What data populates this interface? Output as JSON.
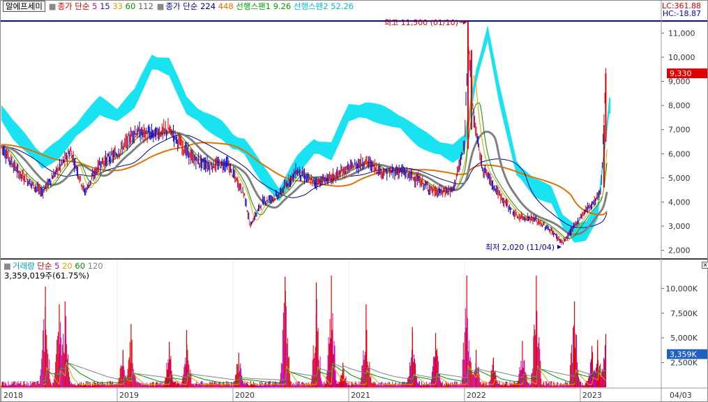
{
  "app": {
    "stock_name": "알에프세미",
    "lc_label": "LC:361.88",
    "hc_label": "HC:-18.87",
    "last_date_label": "04/03"
  },
  "price_legend": {
    "ma_label": "종가 단순",
    "ma_periods": [
      {
        "value": "5",
        "color": "#c000c0"
      },
      {
        "value": "15",
        "color": "#202090"
      },
      {
        "value": "33",
        "color": "#e0a000"
      },
      {
        "value": "60",
        "color": "#009000"
      },
      {
        "value": "112",
        "color": "#606060"
      }
    ],
    "ma2_label": "종가 단순",
    "ma2_periods": [
      {
        "value": "224",
        "color": "#000080"
      },
      {
        "value": "448",
        "color": "#e07000"
      }
    ],
    "span1": "선행스팬1 9.26",
    "span2": "선행스팬2 52.26"
  },
  "volume_legend": {
    "title": "거래량",
    "ma_label": "단순",
    "periods": [
      {
        "value": "5",
        "color": "#c000c0"
      },
      {
        "value": "20",
        "color": "#e0a000"
      },
      {
        "value": "60",
        "color": "#009000"
      },
      {
        "value": "120",
        "color": "#808080"
      }
    ],
    "current": "3,359,019주(61.75%)"
  },
  "annotations": {
    "high": "최고 11,500 (01/10)",
    "low": "최저 2,020 (11/04)"
  },
  "colors": {
    "up": "#e00000",
    "down": "#0000cc",
    "cloud": "#00e0f0",
    "hc_line": "#00009a",
    "badge_price": "#e00000",
    "badge_volume": "#2060c0"
  },
  "chart_data": [
    {
      "type": "candlestick",
      "title": "알에프세미",
      "ylim": [
        2000,
        11500
      ],
      "y_ticks": [
        "2,000",
        "3,000",
        "4,000",
        "5,000",
        "6,000",
        "7,000",
        "8,000",
        "9,000",
        "10,000",
        "11,000"
      ],
      "x_ticks": [
        "2018",
        "2019",
        "2020",
        "2021",
        "2022",
        "2023",
        "04/03"
      ],
      "current_price": "9,330",
      "high": {
        "value": 11500,
        "date": "01/10"
      },
      "low": {
        "value": 2020,
        "date": "11/04"
      },
      "price_path": [
        [
          2018.0,
          6300
        ],
        [
          2018.15,
          5200
        ],
        [
          2018.35,
          4400
        ],
        [
          2018.48,
          5300
        ],
        [
          2018.6,
          6100
        ],
        [
          2018.72,
          4400
        ],
        [
          2018.85,
          5600
        ],
        [
          2019.0,
          6000
        ],
        [
          2019.15,
          6900
        ],
        [
          2019.3,
          6800
        ],
        [
          2019.45,
          7000
        ],
        [
          2019.55,
          6400
        ],
        [
          2019.65,
          5800
        ],
        [
          2019.8,
          5500
        ],
        [
          2019.95,
          5600
        ],
        [
          2020.1,
          4300
        ],
        [
          2020.15,
          3000
        ],
        [
          2020.25,
          4000
        ],
        [
          2020.4,
          4300
        ],
        [
          2020.55,
          5300
        ],
        [
          2020.7,
          4800
        ],
        [
          2020.85,
          5000
        ],
        [
          2021.0,
          5400
        ],
        [
          2021.15,
          5700
        ],
        [
          2021.3,
          5200
        ],
        [
          2021.45,
          5300
        ],
        [
          2021.6,
          4900
        ],
        [
          2021.75,
          4400
        ],
        [
          2021.9,
          4500
        ],
        [
          2022.0,
          6300
        ],
        [
          2022.03,
          10800
        ],
        [
          2022.08,
          7500
        ],
        [
          2022.15,
          5500
        ],
        [
          2022.3,
          4300
        ],
        [
          2022.45,
          3400
        ],
        [
          2022.6,
          3300
        ],
        [
          2022.75,
          2800
        ],
        [
          2022.85,
          2300
        ],
        [
          2022.95,
          3000
        ],
        [
          2023.05,
          3700
        ],
        [
          2023.12,
          4000
        ],
        [
          2023.18,
          4500
        ],
        [
          2023.22,
          9300
        ]
      ],
      "cloud_path": [
        [
          2018.0,
          7700
        ],
        [
          2018.1,
          7000
        ],
        [
          2018.2,
          6500
        ],
        [
          2018.35,
          5700
        ],
        [
          2018.5,
          6200
        ],
        [
          2018.65,
          7000
        ],
        [
          2018.85,
          8000
        ],
        [
          2019.0,
          7600
        ],
        [
          2019.15,
          8300
        ],
        [
          2019.3,
          9800
        ],
        [
          2019.45,
          9600
        ],
        [
          2019.6,
          8000
        ],
        [
          2019.75,
          7400
        ],
        [
          2019.9,
          7000
        ],
        [
          2020.0,
          6500
        ],
        [
          2020.1,
          6300
        ],
        [
          2020.25,
          5200
        ],
        [
          2020.4,
          4300
        ],
        [
          2020.55,
          5500
        ],
        [
          2020.7,
          6300
        ],
        [
          2020.85,
          6100
        ],
        [
          2021.0,
          7700
        ],
        [
          2021.15,
          7800
        ],
        [
          2021.3,
          7600
        ],
        [
          2021.45,
          7300
        ],
        [
          2021.6,
          6700
        ],
        [
          2021.75,
          6300
        ],
        [
          2021.9,
          6000
        ],
        [
          2022.0,
          6400
        ],
        [
          2022.1,
          9200
        ],
        [
          2022.2,
          11000
        ],
        [
          2022.3,
          8500
        ],
        [
          2022.45,
          5400
        ],
        [
          2022.6,
          4600
        ],
        [
          2022.75,
          4300
        ],
        [
          2022.85,
          3200
        ],
        [
          2022.95,
          2700
        ],
        [
          2023.05,
          2800
        ],
        [
          2023.15,
          3600
        ],
        [
          2023.25,
          8000
        ]
      ]
    },
    {
      "type": "bar",
      "title": "거래량",
      "ylim": [
        0,
        12000
      ],
      "y_ticks": [
        "2,500K",
        "5,000K",
        "7,500K",
        "10,000K"
      ],
      "current_volume": "3,359K",
      "peaks": [
        [
          2018.38,
          10200
        ],
        [
          2018.5,
          8400
        ],
        [
          2018.55,
          8700
        ],
        [
          2019.05,
          3800
        ],
        [
          2019.12,
          6400
        ],
        [
          2019.45,
          4600
        ],
        [
          2019.6,
          5800
        ],
        [
          2020.05,
          3500
        ],
        [
          2020.45,
          11200
        ],
        [
          2020.72,
          10600
        ],
        [
          2020.85,
          11300
        ],
        [
          2020.95,
          2500
        ],
        [
          2021.15,
          8400
        ],
        [
          2021.55,
          6100
        ],
        [
          2021.75,
          5500
        ],
        [
          2022.02,
          11300
        ],
        [
          2022.1,
          3800
        ],
        [
          2022.25,
          3000
        ],
        [
          2022.5,
          4700
        ],
        [
          2022.62,
          11300
        ],
        [
          2022.95,
          8700
        ],
        [
          2023.1,
          4200
        ],
        [
          2023.15,
          4800
        ],
        [
          2023.22,
          5400
        ]
      ]
    }
  ]
}
